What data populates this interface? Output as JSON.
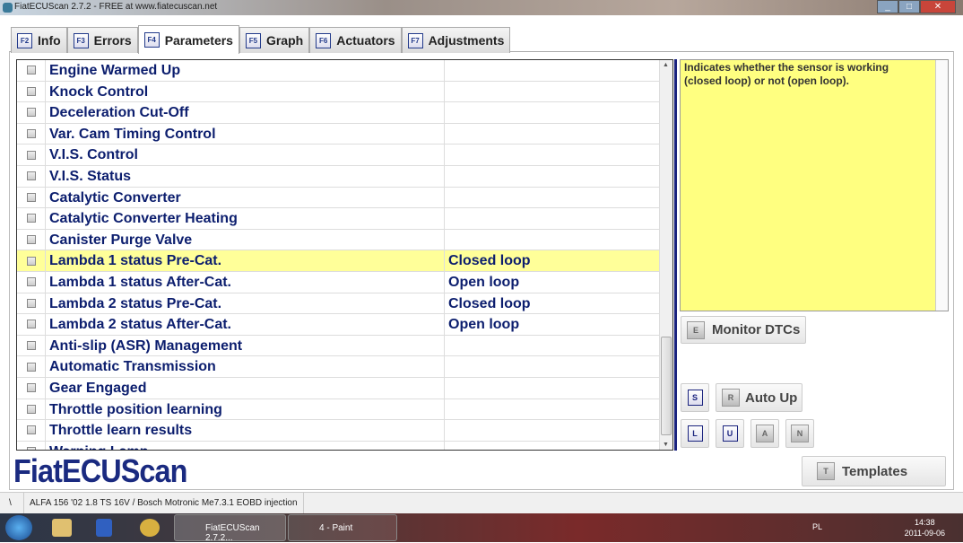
{
  "window": {
    "title": "FiatECUScan 2.7.2 - FREE at www.fiatecuscan.net"
  },
  "tabs": [
    {
      "key": "F2",
      "label": "Info"
    },
    {
      "key": "F3",
      "label": "Errors"
    },
    {
      "key": "F4",
      "label": "Parameters",
      "active": true
    },
    {
      "key": "F5",
      "label": "Graph"
    },
    {
      "key": "F6",
      "label": "Actuators"
    },
    {
      "key": "F7",
      "label": "Adjustments"
    }
  ],
  "parameters": [
    {
      "name": "Engine Warmed Up",
      "value": ""
    },
    {
      "name": "Knock Control",
      "value": ""
    },
    {
      "name": "Deceleration Cut-Off",
      "value": ""
    },
    {
      "name": "Var. Cam Timing Control",
      "value": ""
    },
    {
      "name": "V.I.S. Control",
      "value": ""
    },
    {
      "name": "V.I.S. Status",
      "value": ""
    },
    {
      "name": "Catalytic Converter",
      "value": ""
    },
    {
      "name": "Catalytic Converter Heating",
      "value": ""
    },
    {
      "name": "Canister Purge Valve",
      "value": ""
    },
    {
      "name": "Lambda 1 status Pre-Cat.",
      "value": "Closed loop",
      "selected": true
    },
    {
      "name": "Lambda 1 status After-Cat.",
      "value": "Open loop"
    },
    {
      "name": "Lambda 2 status Pre-Cat.",
      "value": "Closed loop"
    },
    {
      "name": "Lambda 2 status After-Cat.",
      "value": "Open loop"
    },
    {
      "name": "Anti-slip (ASR) Management",
      "value": ""
    },
    {
      "name": "Automatic Transmission",
      "value": ""
    },
    {
      "name": "Gear Engaged",
      "value": ""
    },
    {
      "name": "Throttle position learning",
      "value": ""
    },
    {
      "name": "Throttle learn results",
      "value": ""
    },
    {
      "name": "Warning Lamp",
      "value": ""
    }
  ],
  "help": {
    "text": "Indicates whether the sensor is working (closed loop) or not (open loop)."
  },
  "buttons": {
    "monitor": {
      "key": "E",
      "label": "Monitor DTCs"
    },
    "s": {
      "key": "S"
    },
    "autoup": {
      "key": "R",
      "label": "Auto Up"
    },
    "l": {
      "key": "L"
    },
    "u": {
      "key": "U"
    },
    "a": {
      "key": "A"
    },
    "n": {
      "key": "N"
    },
    "templates": {
      "key": "T",
      "label": "Templates"
    }
  },
  "logo": "FiatECUScan",
  "status": {
    "sep": "\\",
    "vehicle": "ALFA 156 '02 1.8 TS 16V / Bosch Motronic Me7.3.1 EOBD injection"
  },
  "taskbar": {
    "tasks": [
      "FiatECUScan 2.7.2...",
      "4 - Paint"
    ],
    "lang": "PL",
    "time": "14:38",
    "date": "2011-09-06"
  }
}
